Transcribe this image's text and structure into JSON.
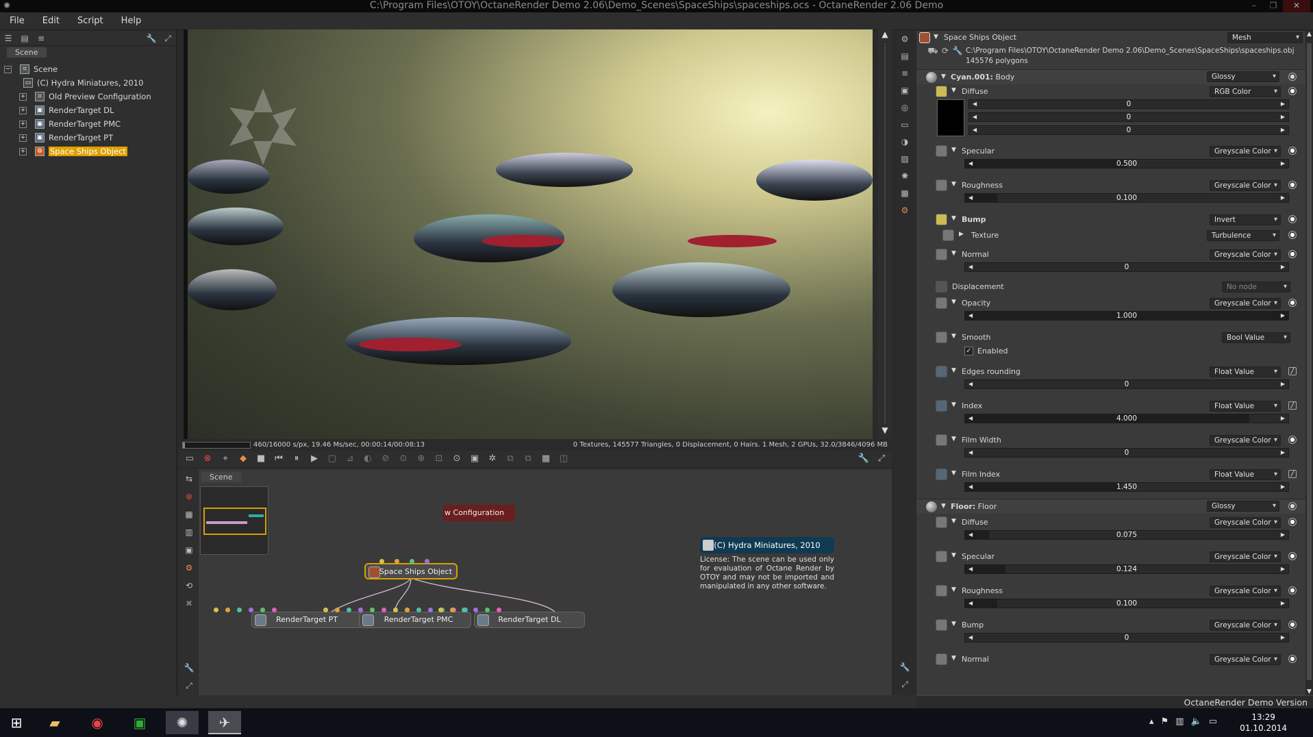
{
  "window": {
    "title": "C:\\Program Files\\OTOY\\OctaneRender Demo 2.06\\Demo_Scenes\\SpaceShips\\spaceships.ocs - OctaneRender 2.06 Demo"
  },
  "menu": [
    "File",
    "Edit",
    "Script",
    "Help"
  ],
  "outliner": {
    "tab": "Scene",
    "items": [
      {
        "label": "Scene",
        "icon": "scene-icon"
      },
      {
        "label": "(C) Hydra Miniatures, 2010",
        "icon": "comment-icon"
      },
      {
        "label": "Old Preview Configuration",
        "icon": "config-icon"
      },
      {
        "label": "RenderTarget DL",
        "icon": "rendertarget-icon"
      },
      {
        "label": "RenderTarget PMC",
        "icon": "rendertarget-icon"
      },
      {
        "label": "RenderTarget PT",
        "icon": "rendertarget-icon"
      },
      {
        "label": "Space Ships Object",
        "icon": "mesh-icon",
        "selected": true
      }
    ]
  },
  "render_status": {
    "left": "460/16000 s/px, 19.46 Ms/sec, 00:00:14/00:08:13",
    "right": "0 Textures, 145577 Triangles, 0 Displacement, 0 Hairs. 1 Mesh, 2 GPUs, 32.0/3846/4096 MB",
    "progress": 0.029
  },
  "graph": {
    "tab": "Scene",
    "config_node": "w Configuration",
    "space_node": "Space Ships Object",
    "rt_nodes": [
      "RenderTarget PT",
      "RenderTarget PMC",
      "RenderTarget DL"
    ],
    "comment_title": "(C) Hydra Miniatures, 2010",
    "comment_text": "License: The scene can be used only for evaluation of Octane Render by OTOY and may not be imported and manipulated in any other software."
  },
  "inspector": {
    "node_title": "Space Ships Object",
    "node_type": "Mesh",
    "path": "C:\\Program Files\\OTOY\\OctaneRender Demo 2.06\\Demo_Scenes\\SpaceShips\\spaceships.obj",
    "polygons": "145576 polygons",
    "mat1_name": "Cyan.001:",
    "mat1_sub": "Body",
    "mat1_type": "Glossy",
    "p_diffuse": "Diffuse",
    "p_diffuse_t": "RGB Color",
    "rgb": [
      "0",
      "0",
      "0"
    ],
    "p_specular": "Specular",
    "p_specular_t": "Greyscale Color",
    "v_specular": "0.500",
    "p_rough": "Roughness",
    "p_rough_t": "Greyscale Color",
    "v_rough": "0.100",
    "p_bump": "Bump",
    "p_bump_t": "Invert",
    "p_texture": "Texture",
    "p_texture_t": "Turbulence",
    "p_normal": "Normal",
    "p_normal_t": "Greyscale Color",
    "v_normal": "0",
    "p_disp": "Displacement",
    "p_disp_t": "No node",
    "p_opacity": "Opacity",
    "p_opacity_t": "Greyscale Color",
    "v_opacity": "1.000",
    "p_smooth": "Smooth",
    "p_smooth_t": "Bool Value",
    "p_enabled": "Enabled",
    "p_edges": "Edges rounding",
    "p_edges_t": "Float Value",
    "v_edges": "0",
    "p_index": "Index",
    "p_index_t": "Float Value",
    "v_index": "4.000",
    "p_fw": "Film Width",
    "p_fw_t": "Greyscale Color",
    "v_fw": "0",
    "p_fi": "Film Index",
    "p_fi_t": "Float Value",
    "v_fi": "1.450",
    "mat2_name": "Floor:",
    "mat2_sub": "Floor",
    "mat2_type": "Glossy",
    "f_diffuse": "Diffuse",
    "f_diffuse_t": "Greyscale Color",
    "vf_diffuse": "0.075",
    "f_spec": "Specular",
    "f_spec_t": "Greyscale Color",
    "vf_spec": "0.124",
    "f_rough": "Roughness",
    "f_rough_t": "Greyscale Color",
    "vf_rough": "0.100",
    "f_bump": "Bump",
    "f_bump_t": "Greyscale Color",
    "vf_bump": "0",
    "f_normal": "Normal",
    "f_normal_t": "Greyscale Color"
  },
  "footer": "OctaneRender Demo Version",
  "taskbar": {
    "time": "13:29",
    "date": "01.10.2014"
  }
}
